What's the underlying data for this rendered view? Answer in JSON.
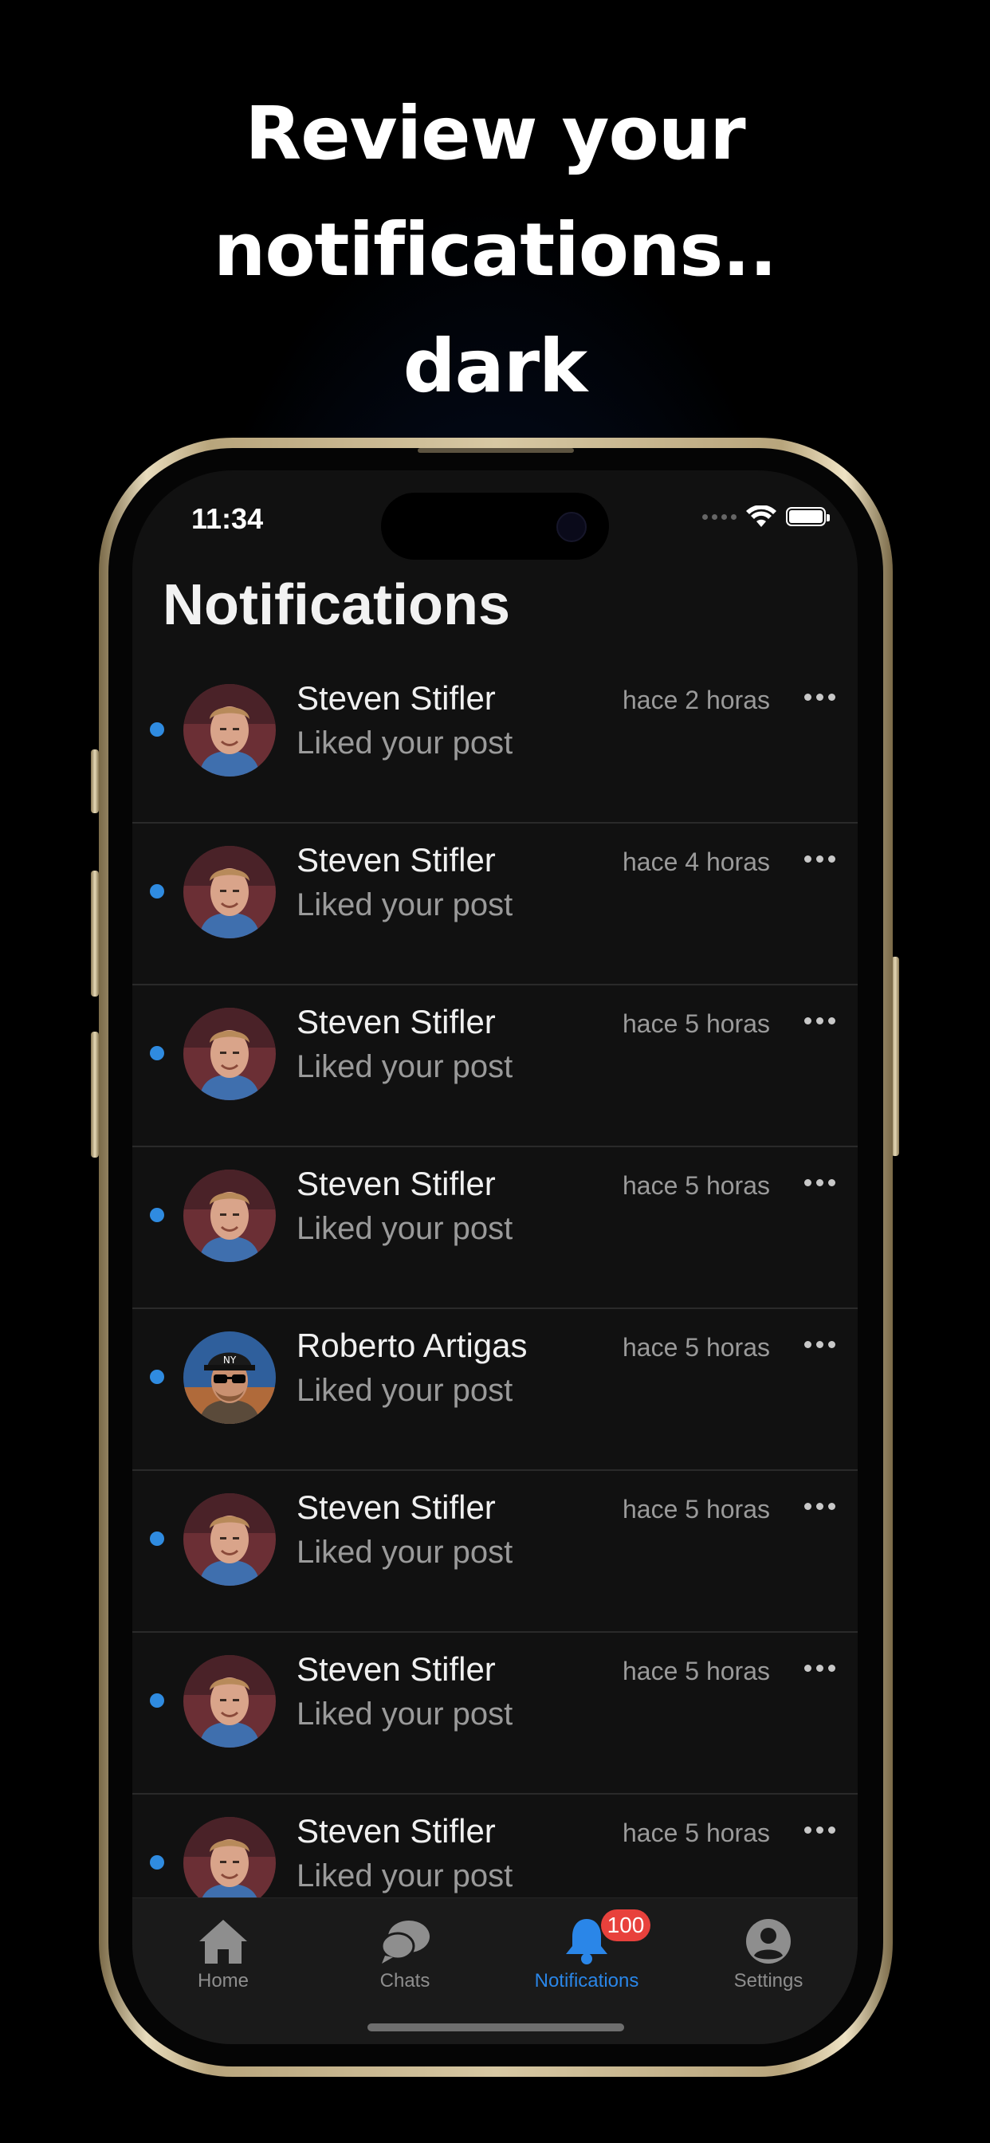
{
  "promo": {
    "headline_line1": "Review your",
    "headline_line2": "notifications..",
    "headline_line3": "dark"
  },
  "status_bar": {
    "time": "11:34",
    "icons": [
      "signal-dots-icon",
      "wifi-icon",
      "battery-icon"
    ]
  },
  "screen": {
    "title": "Notifications"
  },
  "notifications": [
    {
      "name": "Steven Stifler",
      "message": "Liked your post",
      "time": "hace 2 horas",
      "unread": true,
      "avatar": "steven"
    },
    {
      "name": "Steven Stifler",
      "message": "Liked your post",
      "time": "hace 4 horas",
      "unread": true,
      "avatar": "steven"
    },
    {
      "name": "Steven Stifler",
      "message": "Liked your post",
      "time": "hace 5 horas",
      "unread": true,
      "avatar": "steven"
    },
    {
      "name": "Steven Stifler",
      "message": "Liked your post",
      "time": "hace 5 horas",
      "unread": true,
      "avatar": "steven"
    },
    {
      "name": "Roberto Artigas",
      "message": "Liked your post",
      "time": "hace 5 horas",
      "unread": true,
      "avatar": "roberto"
    },
    {
      "name": "Steven Stifler",
      "message": "Liked your post",
      "time": "hace 5 horas",
      "unread": true,
      "avatar": "steven"
    },
    {
      "name": "Steven Stifler",
      "message": "Liked your post",
      "time": "hace 5 horas",
      "unread": true,
      "avatar": "steven"
    },
    {
      "name": "Steven Stifler",
      "message": "Liked your post",
      "time": "hace 5 horas",
      "unread": true,
      "avatar": "steven"
    }
  ],
  "tab_bar": {
    "tabs": [
      {
        "label": "Home",
        "icon": "house-icon",
        "active": false
      },
      {
        "label": "Chats",
        "icon": "chat-bubbles-icon",
        "active": false
      },
      {
        "label": "Notifications",
        "icon": "bell-icon",
        "active": true,
        "badge": "100"
      },
      {
        "label": "Settings",
        "icon": "person-circle-icon",
        "active": false
      }
    ]
  },
  "colors": {
    "accent": "#2a86e8",
    "unread_dot": "#2f8be0",
    "badge": "#e8413c",
    "background": "#111111"
  }
}
